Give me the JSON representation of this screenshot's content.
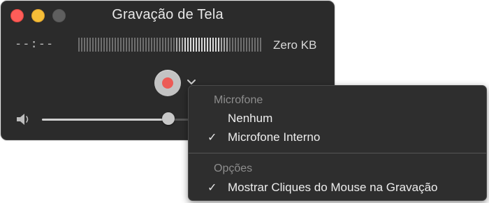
{
  "window": {
    "title": "Gravação de Tela",
    "time_display": "--:--",
    "file_size": "Zero KB",
    "audio_level_fraction": 0.67,
    "volume_fraction": 0.84
  },
  "menu": {
    "sections": [
      {
        "header": "Microfone",
        "items": [
          {
            "label": "Nenhum",
            "check": ""
          },
          {
            "label": "Microfone Interno",
            "check": "✓"
          }
        ]
      },
      {
        "header": "Opções",
        "items": [
          {
            "label": "Mostrar Cliques do Mouse na Gravação",
            "check": "✓"
          }
        ]
      }
    ]
  },
  "colors": {
    "window_bg": "#2b2b2b",
    "record_red": "#ec5b56",
    "close_red": "#fe5d59",
    "minimize_yellow": "#f6be38"
  },
  "icons": {
    "close": "close-button-icon",
    "minimize": "minimize-button-icon",
    "zoom": "zoom-button-icon",
    "record": "record-dot-icon",
    "options": "chevron-down-icon",
    "volume": "speaker-icon",
    "checkmark": "checkmark-icon"
  }
}
